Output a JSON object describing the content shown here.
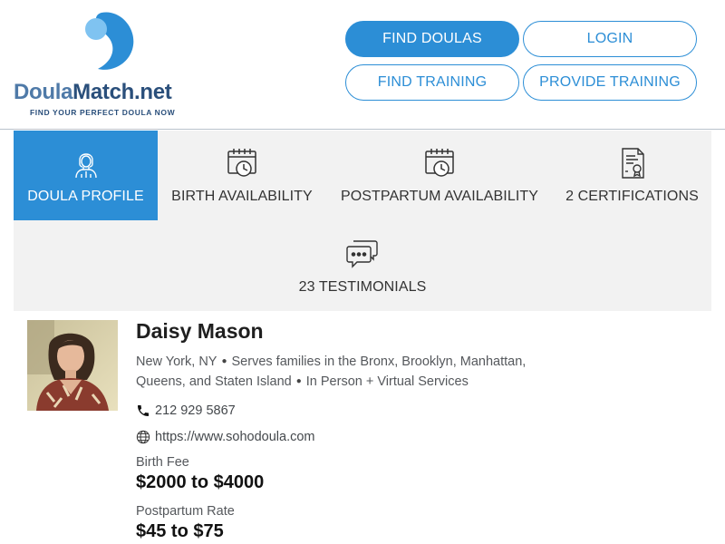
{
  "logo": {
    "name_part1": "Doula",
    "name_part2": "Match.net",
    "tagline": "FIND YOUR PERFECT DOULA NOW"
  },
  "nav": {
    "find_doulas": "FIND DOULAS",
    "login": "LOGIN",
    "find_training": "FIND TRAINING",
    "provide_training": "PROVIDE TRAINING"
  },
  "tabs": {
    "profile": "DOULA PROFILE",
    "birth": "BIRTH AVAILABILITY",
    "postpartum": "POSTPARTUM AVAILABILITY",
    "certifications": "2 CERTIFICATIONS",
    "testimonials": "23 TESTIMONIALS"
  },
  "profile": {
    "name": "Daisy Mason",
    "city": "New York, NY",
    "serves": "Serves families in the Bronx, Brooklyn, Manhattan, Queens, and Staten Island",
    "services": "In Person + Virtual Services",
    "phone": "212 929 5867",
    "website": "https://www.sohodoula.com",
    "birth_fee_label": "Birth Fee",
    "birth_fee": "$2000 to $4000",
    "postpartum_label": "Postpartum Rate",
    "postpartum_rate": "$45 to $75"
  },
  "icons": {
    "profile_tab": "doula-person-icon",
    "birth_tab": "calendar-clock-icon",
    "postpartum_tab": "calendar-clock-icon",
    "certs_tab": "certificate-icon",
    "testimonials_tab": "chat-bubbles-icon",
    "phone": "phone-icon",
    "website": "globe-icon"
  },
  "colors": {
    "accent": "#2c8ed6",
    "logo_light": "#4f7aa8",
    "logo_dark": "#2a4f7b",
    "tab_bg": "#f2f2f2"
  }
}
